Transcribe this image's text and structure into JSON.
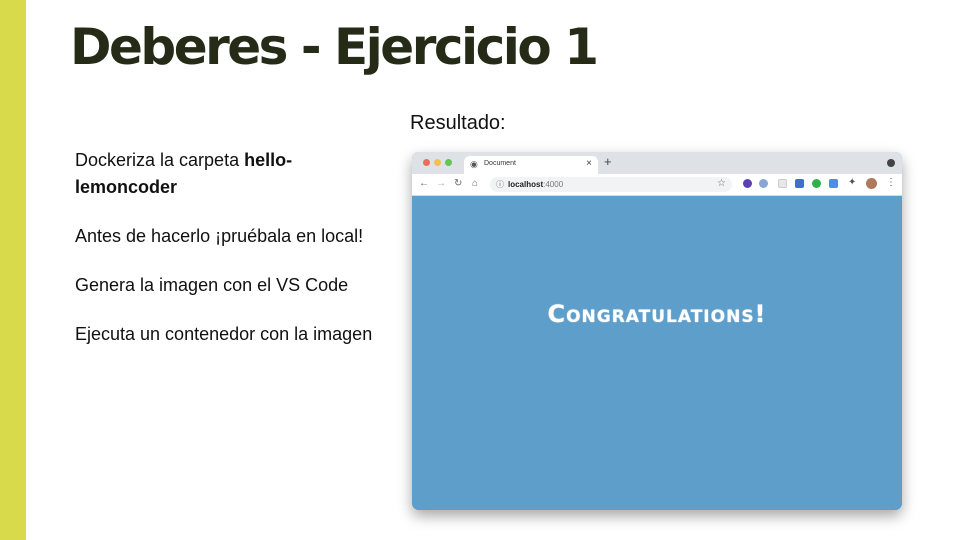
{
  "slide": {
    "title": "Deberes - Ejercicio 1",
    "accent_color": "#d9da4b",
    "items": [
      {
        "text": "Dockeriza la carpeta ",
        "bold": "hello-lemoncoder"
      },
      {
        "text": "Antes de hacerlo ¡pruébala en local!"
      },
      {
        "text": "Genera la imagen con el VS Code"
      },
      {
        "text": "Ejecuta un contenedor con la imagen"
      }
    ],
    "result_label": "Resultado:"
  },
  "browser": {
    "tab_title": "Document",
    "tab_icon": "globe-icon",
    "url_host": "localhost",
    "url_port": ":4000",
    "page_background": "#5d9ecb",
    "page_heading": "Congratulations!"
  }
}
